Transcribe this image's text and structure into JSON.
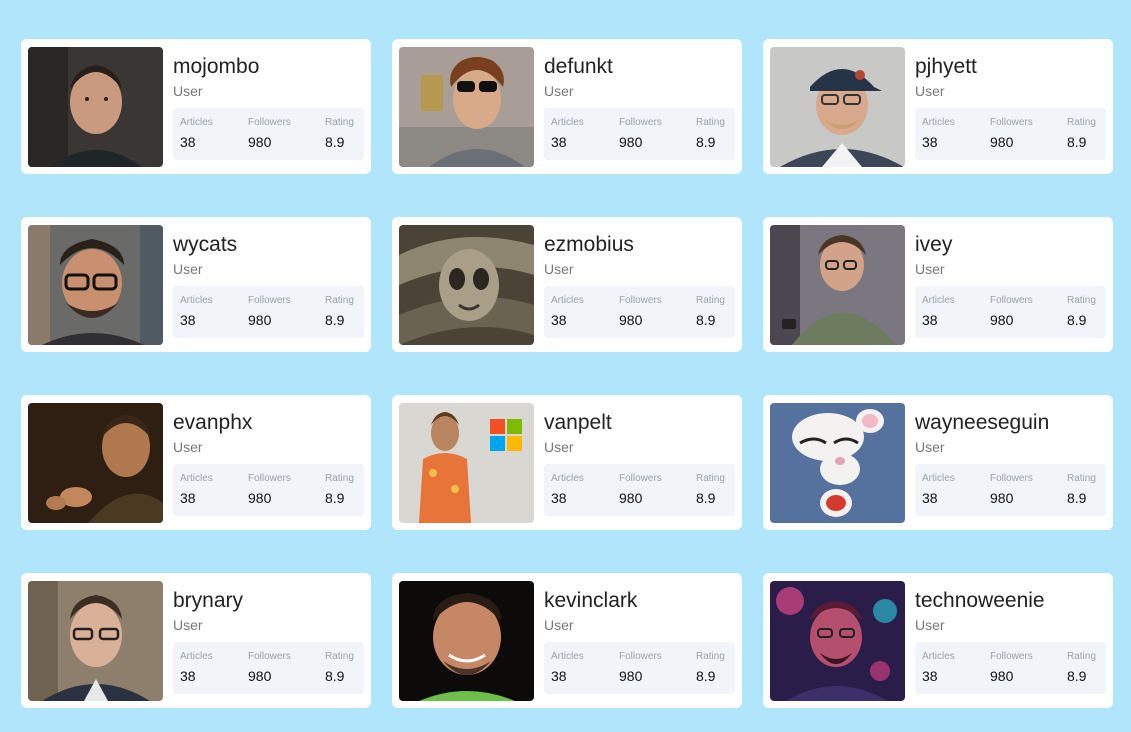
{
  "users": [
    {
      "name": "mojombo",
      "role": "User",
      "stats": {
        "articles_label": "Articles",
        "articles": "38",
        "followers_label": "Followers",
        "followers": "980",
        "rating_label": "Rating",
        "rating": "8.9"
      }
    },
    {
      "name": "defunkt",
      "role": "User",
      "stats": {
        "articles_label": "Articles",
        "articles": "38",
        "followers_label": "Followers",
        "followers": "980",
        "rating_label": "Rating",
        "rating": "8.9"
      }
    },
    {
      "name": "pjhyett",
      "role": "User",
      "stats": {
        "articles_label": "Articles",
        "articles": "38",
        "followers_label": "Followers",
        "followers": "980",
        "rating_label": "Rating",
        "rating": "8.9"
      }
    },
    {
      "name": "wycats",
      "role": "User",
      "stats": {
        "articles_label": "Articles",
        "articles": "38",
        "followers_label": "Followers",
        "followers": "980",
        "rating_label": "Rating",
        "rating": "8.9"
      }
    },
    {
      "name": "ezmobius",
      "role": "User",
      "stats": {
        "articles_label": "Articles",
        "articles": "38",
        "followers_label": "Followers",
        "followers": "980",
        "rating_label": "Rating",
        "rating": "8.9"
      }
    },
    {
      "name": "ivey",
      "role": "User",
      "stats": {
        "articles_label": "Articles",
        "articles": "38",
        "followers_label": "Followers",
        "followers": "980",
        "rating_label": "Rating",
        "rating": "8.9"
      }
    },
    {
      "name": "evanphx",
      "role": "User",
      "stats": {
        "articles_label": "Articles",
        "articles": "38",
        "followers_label": "Followers",
        "followers": "980",
        "rating_label": "Rating",
        "rating": "8.9"
      }
    },
    {
      "name": "vanpelt",
      "role": "User",
      "stats": {
        "articles_label": "Articles",
        "articles": "38",
        "followers_label": "Followers",
        "followers": "980",
        "rating_label": "Rating",
        "rating": "8.9"
      }
    },
    {
      "name": "wayneeseguin",
      "role": "User",
      "stats": {
        "articles_label": "Articles",
        "articles": "38",
        "followers_label": "Followers",
        "followers": "980",
        "rating_label": "Rating",
        "rating": "8.9"
      }
    },
    {
      "name": "brynary",
      "role": "User",
      "stats": {
        "articles_label": "Articles",
        "articles": "38",
        "followers_label": "Followers",
        "followers": "980",
        "rating_label": "Rating",
        "rating": "8.9"
      }
    },
    {
      "name": "kevinclark",
      "role": "User",
      "stats": {
        "articles_label": "Articles",
        "articles": "38",
        "followers_label": "Followers",
        "followers": "980",
        "rating_label": "Rating",
        "rating": "8.9"
      }
    },
    {
      "name": "technoweenie",
      "role": "User",
      "stats": {
        "articles_label": "Articles",
        "articles": "38",
        "followers_label": "Followers",
        "followers": "980",
        "rating_label": "Rating",
        "rating": "8.9"
      }
    }
  ],
  "colors": {
    "page_background": "#b0e5fb",
    "card_background": "#ffffff",
    "stats_background": "#f1f4f8"
  }
}
